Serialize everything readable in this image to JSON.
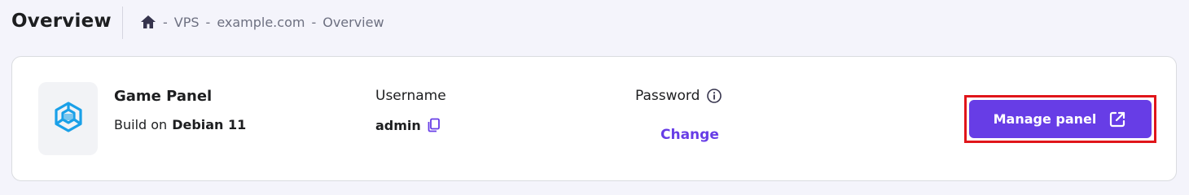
{
  "header": {
    "title": "Overview",
    "breadcrumb": [
      "VPS",
      "example.com",
      "Overview"
    ],
    "separator": " - "
  },
  "panel": {
    "name": "Game Panel",
    "build_prefix": "Build on",
    "os": "Debian 11"
  },
  "credentials": {
    "username_label": "Username",
    "username_value": "admin",
    "password_label": "Password",
    "password_action": "Change"
  },
  "actions": {
    "manage_label": "Manage panel"
  },
  "colors": {
    "accent": "#673de6",
    "logo": "#1aa0e8",
    "highlight": "#e0151a",
    "background": "#f4f4fb"
  },
  "icons": {
    "home": "home-icon",
    "copy": "copy-icon",
    "info": "info-icon",
    "external": "external-link-icon",
    "logo": "game-panel-logo-icon"
  }
}
